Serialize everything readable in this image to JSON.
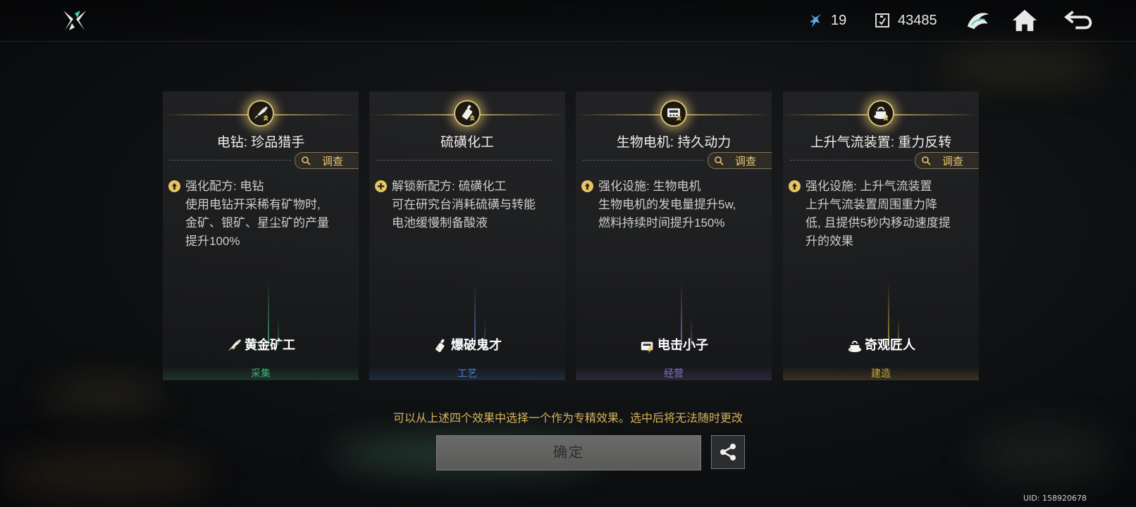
{
  "header": {
    "resources": [
      {
        "icon": "crystal-shard-icon",
        "value": "19"
      },
      {
        "icon": "chip-currency-icon",
        "value": "43485"
      }
    ],
    "buttons": [
      "spirit-emblem-icon",
      "home-icon",
      "back-icon"
    ]
  },
  "cards": [
    {
      "icon": "drill-icon",
      "title": "电钻: 珍品猎手",
      "has_investigate": true,
      "investigate_label": "调查",
      "effect_icon": "upgrade-icon",
      "effect_head": "强化配方: 电钻",
      "effect_lines": [
        "使用电钻开采稀有矿物时,",
        "金矿、银矿、星尘矿的产量",
        "提升100%"
      ],
      "role_icon": "gold-miner-icon",
      "role_name": "黄金矿工",
      "category": "采集",
      "accent": "#3fae7a"
    },
    {
      "icon": "bottle-bomb-icon",
      "title": "硫磺化工",
      "has_investigate": false,
      "investigate_label": "",
      "effect_icon": "unlock-plus-icon",
      "effect_head": "解锁新配方: 硫磺化工",
      "effect_lines": [
        "可在研究台消耗硫磺与转能",
        "电池缓慢制备酸液"
      ],
      "role_icon": "bomb-bottle-icon",
      "role_name": "爆破鬼才",
      "category": "工艺",
      "accent": "#4a7fc8"
    },
    {
      "icon": "bio-motor-icon",
      "title": "生物电机: 持久动力",
      "has_investigate": true,
      "investigate_label": "调查",
      "effect_icon": "upgrade-icon",
      "effect_head": "强化设施: 生物电机",
      "effect_lines": [
        "生物电机的发电量提升5w,",
        "燃料持续时间提升150%"
      ],
      "role_icon": "electric-box-icon",
      "role_name": "电击小子",
      "category": "经营",
      "accent": "#8a72c8"
    },
    {
      "icon": "updraft-device-icon",
      "title": "上升气流装置: 重力反转",
      "has_investigate": true,
      "investigate_label": "调查",
      "effect_icon": "upgrade-icon",
      "effect_head": "强化设施: 上升气流装置",
      "effect_lines": [
        "上升气流装置周围重力降",
        "低, 且提供5秒内移动速度提",
        "升的效果"
      ],
      "role_icon": "craftsman-icon",
      "role_name": "奇观匠人",
      "category": "建造",
      "accent": "#c9a83a"
    }
  ],
  "hint": "可以从上述四个效果中选择一个作为专精效果。选中后将无法随时更改",
  "confirm_label": "确定",
  "share_icon": "share-icon",
  "uid": "UID: 158920678"
}
